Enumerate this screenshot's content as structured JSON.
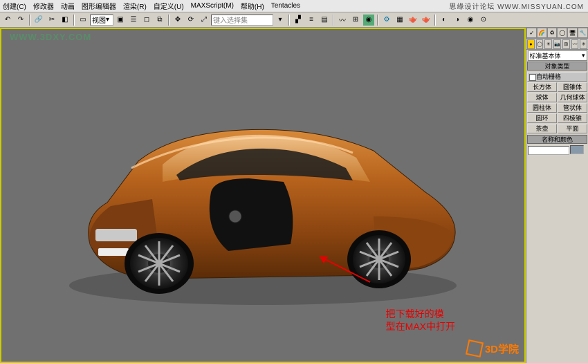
{
  "menu": {
    "items": [
      "创建(C)",
      "修改器",
      "动画",
      "图形编辑器",
      "渲染(R)",
      "自定义(U)",
      "MAXScript(M)",
      "帮助(H)",
      "Tentacles"
    ]
  },
  "topright": "思缘设计论坛   WWW.MISSYUAN.COM",
  "toolbar": {
    "view_btn": "视图",
    "selset_ph": "键入选择集",
    "spinner": "▾"
  },
  "command_panel": {
    "dropdown": "标准基本体",
    "rollout1": "对象类型",
    "autogrid": "自动栅格",
    "buttons": [
      {
        "l": "长方体",
        "r": "圆锥体"
      },
      {
        "l": "球体",
        "r": "几何球体"
      },
      {
        "l": "圆柱体",
        "r": "管状体"
      },
      {
        "l": "圆环",
        "r": "四棱锥"
      },
      {
        "l": "茶壶",
        "r": "平面"
      }
    ],
    "rollout2": "名称和颜色"
  },
  "annotation": {
    "line1": "把下载好的模",
    "line2": "型在MAX中打开"
  },
  "watermark_left": "WWW.3DXY.COM",
  "watermark_br": "3D学院"
}
